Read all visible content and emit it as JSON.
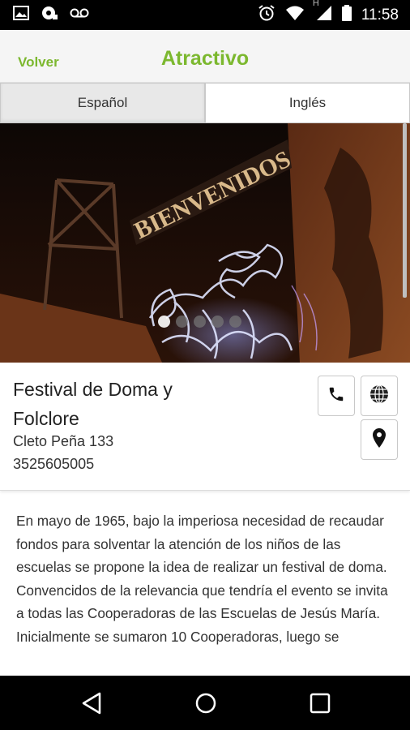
{
  "status_bar": {
    "time": "11:58",
    "network_letter": "H",
    "icons": [
      "gallery-icon",
      "sync-icon",
      "voicemail-icon",
      "alarm-icon",
      "wifi-icon",
      "signal-icon",
      "battery-icon"
    ]
  },
  "header": {
    "back_label": "Volver",
    "title": "Atractivo",
    "accent_color": "#7cb82f"
  },
  "tabs": [
    {
      "label": "Español",
      "active": true
    },
    {
      "label": "Inglés",
      "active": false
    }
  ],
  "banner": {
    "sign_text": "BIENVENIDOS",
    "carousel_dots": 5,
    "active_dot": 0
  },
  "place": {
    "name": "Festival de Doma y Folclore",
    "address": "Cleto Peña 133",
    "phone": "3525605005",
    "actions": [
      "phone-icon",
      "globe-icon",
      "location-pin-icon"
    ]
  },
  "description": "En mayo de 1965, bajo la imperiosa necesidad de recaudar fondos para solventar la atención de los niños de las escuelas se propone la idea de realizar un festival de doma. Convencidos de la relevancia que tendría el evento se invita a todas las Cooperadoras de las Escuelas de Jesús María. Inicialmente se sumaron 10 Cooperadoras, luego se",
  "nav_bar": {
    "icons": [
      "back-triangle-icon",
      "home-circle-icon",
      "recents-square-icon"
    ]
  }
}
